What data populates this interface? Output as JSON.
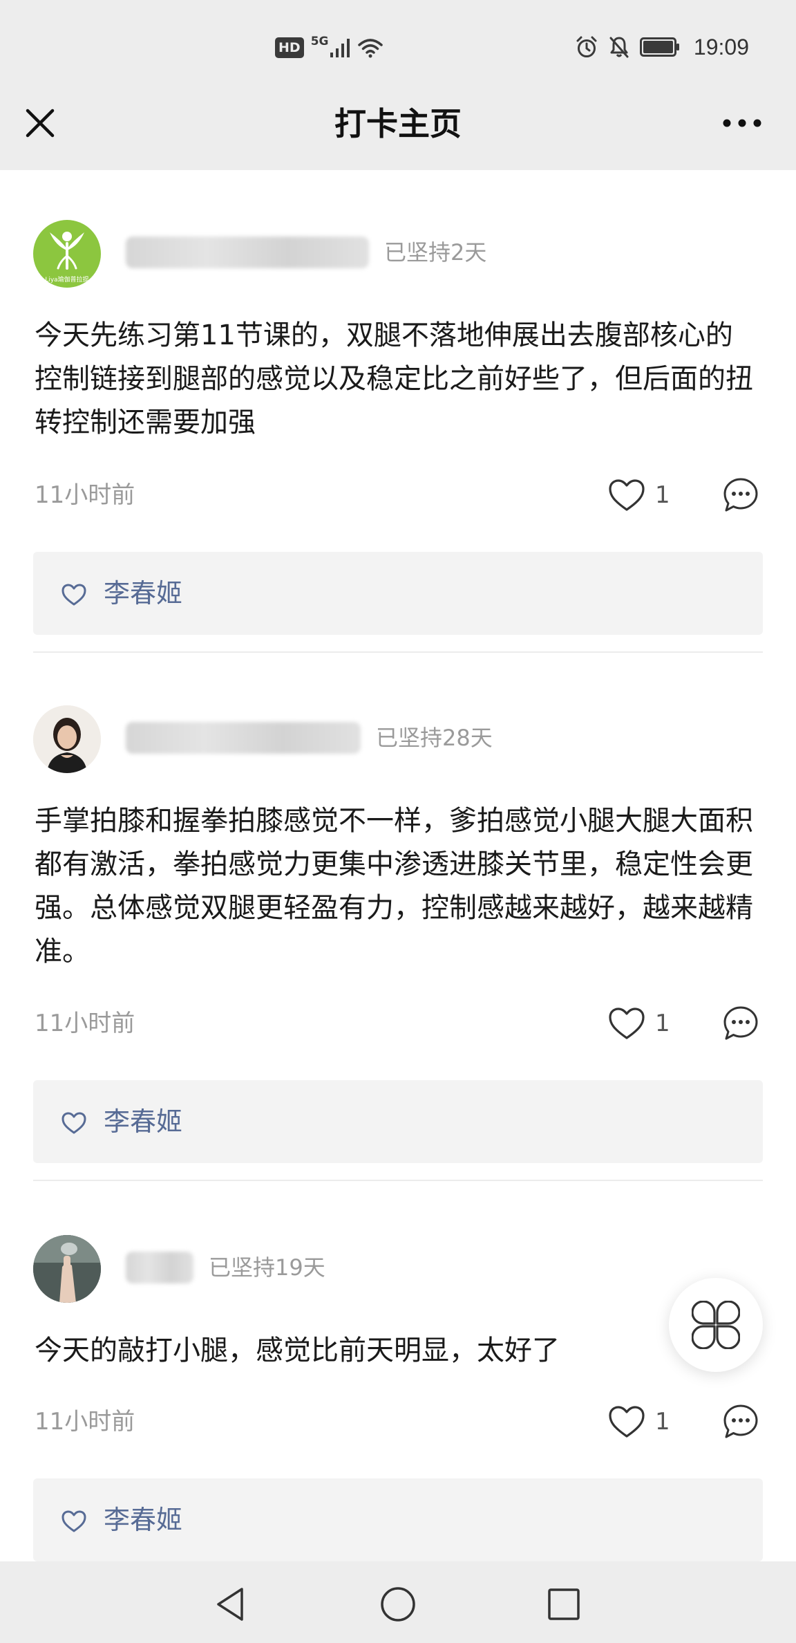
{
  "status_bar": {
    "hd_label": "HD",
    "network_label": "5G",
    "time": "19:09",
    "icons": [
      "signal-icon",
      "wifi-icon",
      "alarm-icon",
      "mute-icon",
      "battery-icon"
    ]
  },
  "nav": {
    "title": "打卡主页",
    "close_icon": "close-icon",
    "more_icon": "more-icon"
  },
  "posts": [
    {
      "avatar_text": "Liya瑜伽普拉提",
      "streak": "已坚持2天",
      "content": "今天先练习第11节课的，双腿不落地伸展出去腹部核心的控制链接到腿部的感觉以及稳定比之前好些了，但后面的扭转控制还需要加强",
      "time": "11小时前",
      "like_count": "1",
      "liked_by": "李春姬"
    },
    {
      "avatar_text": "",
      "streak": "已坚持28天",
      "content": "手掌拍膝和握拳拍膝感觉不一样，爹拍感觉小腿大腿大面积都有激活，拳拍感觉力更集中渗透进膝关节里，稳定性会更强。总体感觉双腿更轻盈有力，控制感越来越好，越来越精准。",
      "time": "11小时前",
      "like_count": "1",
      "liked_by": "李春姬"
    },
    {
      "avatar_text": "",
      "streak": "已坚持19天",
      "content": "今天的敲打小腿，感觉比前天明显，太好了",
      "time": "11小时前",
      "like_count": "1",
      "liked_by": "李春姬"
    }
  ],
  "colors": {
    "link": "#576b95",
    "muted": "#9a9a9a",
    "background_bar": "#ededed",
    "likes_box": "#f3f3f3",
    "avatar_green": "#8cc63f"
  }
}
